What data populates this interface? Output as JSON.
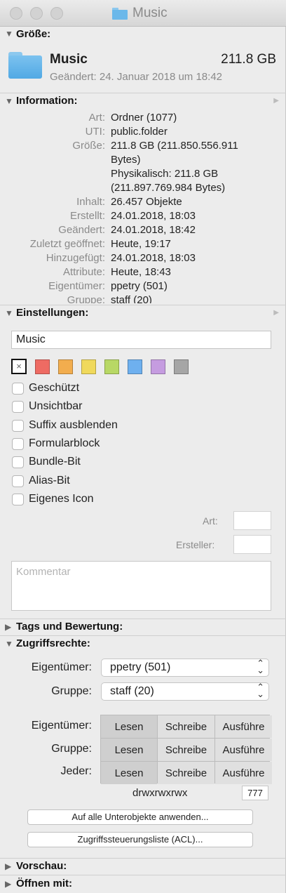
{
  "window": {
    "title": "Music"
  },
  "groesse": {
    "header": "Größe:",
    "name": "Music",
    "size": "211.8 GB",
    "modified": "Geändert: 24. Januar 2018 um 18:42"
  },
  "information": {
    "header": "Information:",
    "rows": [
      {
        "key": "Art:",
        "lines": [
          "Ordner (1077)"
        ]
      },
      {
        "key": "UTI:",
        "lines": [
          "public.folder"
        ]
      },
      {
        "key": "Größe:",
        "lines": [
          "211.8 GB (211.850.556.911",
          "Bytes)",
          "Physikalisch: 211.8 GB",
          "(211.897.769.984 Bytes)"
        ]
      },
      {
        "key": "Inhalt:",
        "lines": [
          "26.457 Objekte"
        ]
      },
      {
        "key": "Erstellt:",
        "lines": [
          "24.01.2018, 18:03"
        ]
      },
      {
        "key": "Geändert:",
        "lines": [
          "24.01.2018, 18:42"
        ]
      },
      {
        "key": "Zuletzt geöffnet:",
        "lines": [
          "Heute, 19:17"
        ]
      },
      {
        "key": "Hinzugefügt:",
        "lines": [
          "24.01.2018, 18:03"
        ]
      },
      {
        "key": "Attribute:",
        "lines": [
          "Heute, 18:43"
        ]
      },
      {
        "key": "Eigentümer:",
        "lines": [
          "ppetry (501)"
        ]
      },
      {
        "key": "Gruppe:",
        "lines": [
          "staff (20)"
        ]
      }
    ]
  },
  "einstellungen": {
    "header": "Einstellungen:",
    "name_value": "Music",
    "none_mark": "×",
    "label_colors": [
      "#ee6b63",
      "#f2ad4e",
      "#f0d95b",
      "#b8d865",
      "#6eb0ef",
      "#c59ce0",
      "#a6a6a6"
    ],
    "checkboxes": [
      "Geschützt",
      "Unsichtbar",
      "Suffix ausblenden",
      "Formularblock",
      "Bundle-Bit",
      "Alias-Bit",
      "Eigenes Icon"
    ],
    "art_label": "Art:",
    "ersteller_label": "Ersteller:",
    "comment_placeholder": "Kommentar"
  },
  "tags": {
    "header": "Tags und Bewertung:"
  },
  "zugriff": {
    "header": "Zugriffsrechte:",
    "owner_label": "Eigentümer:",
    "owner_value": "ppetry (501)",
    "group_label": "Gruppe:",
    "group_value": "staff (20)",
    "rows": [
      {
        "label": "Eigentümer:",
        "cells": [
          "Lesen",
          "Schreibe",
          "Ausführe"
        ]
      },
      {
        "label": "Gruppe:",
        "cells": [
          "Lesen",
          "Schreibe",
          "Ausführe"
        ]
      },
      {
        "label": "Jeder:",
        "cells": [
          "Lesen",
          "Schreibe",
          "Ausführe"
        ]
      }
    ],
    "mode": "drwxrwxrwx",
    "octal": "777",
    "apply_button": "Auf alle Unterobjekte anwenden...",
    "acl_button": "Zugriffssteuerungsliste (ACL)..."
  },
  "vorschau": {
    "header": "Vorschau:"
  },
  "oeffnen": {
    "header": "Öffnen mit:"
  },
  "icons": {
    "expanded": "▼",
    "collapsed": "▶",
    "side_arrow": "▶",
    "popup_arrows": "⌃⌄"
  }
}
